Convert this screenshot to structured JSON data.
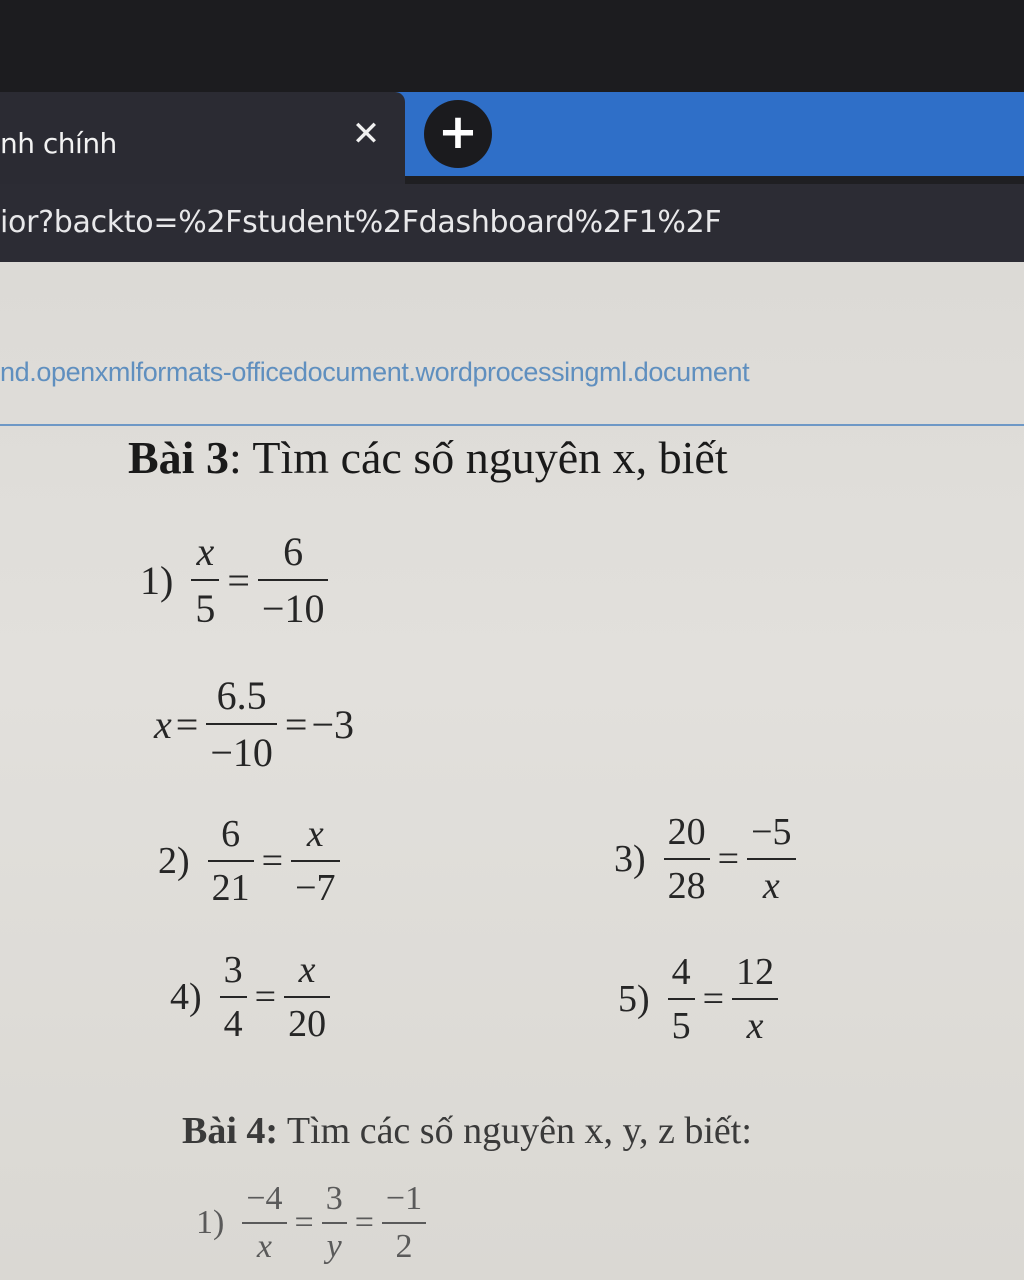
{
  "browser": {
    "tab_title": "nh chính",
    "tab_close_icon": "close-icon",
    "new_tab_label": "+",
    "url": "ior?backto=%2Fstudent%2Fdashboard%2F1%2F"
  },
  "page": {
    "mime_text": "nd.openxmlformats-officedocument.wordprocessingml.document"
  },
  "exercise3": {
    "label": "Bài 3",
    "title_rest": ": Tìm các số nguyên x, biết",
    "items": [
      {
        "index": "1)",
        "lhs_num": "x",
        "lhs_den": "5",
        "eq": "=",
        "rhs_num": "6",
        "rhs_den": "−10"
      },
      {
        "index": "2)",
        "lhs_num": "6",
        "lhs_den": "21",
        "eq": "=",
        "rhs_num": "x",
        "rhs_den": "−7"
      },
      {
        "index": "3)",
        "lhs_num": "20",
        "lhs_den": "28",
        "eq": "=",
        "rhs_num": "−5",
        "rhs_den": "x"
      },
      {
        "index": "4)",
        "lhs_num": "3",
        "lhs_den": "4",
        "eq": "=",
        "rhs_num": "x",
        "rhs_den": "20"
      },
      {
        "index": "5)",
        "lhs_num": "4",
        "lhs_den": "5",
        "eq": "=",
        "rhs_num": "12",
        "rhs_den": "x"
      }
    ],
    "solution1": {
      "var": "x",
      "eq1": "=",
      "num": "6.5",
      "den": "−10",
      "eq2": "=",
      "result": "−3"
    }
  },
  "exercise4": {
    "label": "Bài 4:",
    "title_rest": " Tìm các số nguyên x, y, z biết:",
    "items": [
      {
        "index": "1)",
        "a_num": "−4",
        "a_den": "x",
        "eq1": "=",
        "b_num": "3",
        "b_den": "y",
        "eq2": "=",
        "c_num": "−1",
        "c_den": "2"
      }
    ]
  }
}
